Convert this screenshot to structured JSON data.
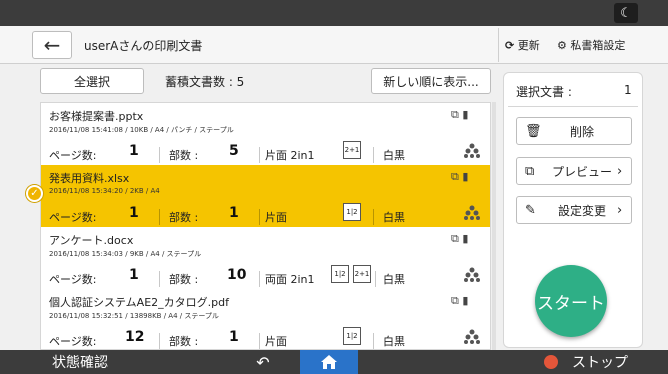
{
  "header": {
    "title": "userAさんの印刷文書",
    "update_label": "更新",
    "mybox_label": "私書箱設定"
  },
  "toolbar": {
    "select_all_label": "全選択",
    "stored_count_label": "蓄積文書数 : 5",
    "sort_label": "新しい順に表示..."
  },
  "labels": {
    "pages": "ページ数:",
    "copies": "部数 :",
    "bw": "白黒"
  },
  "documents": [
    {
      "name": "お客様提案書.pptx",
      "meta": "2016/11/08 15:41:08 / 10KB / A4 / パンチ / ステープル",
      "pages": "1",
      "copies": "5",
      "duplex": "片面 2in1",
      "icon1": "2+1",
      "icon2": "",
      "selected": false
    },
    {
      "name": "発表用資料.xlsx",
      "meta": "2016/11/08 15:34:20 / 2KB / A4",
      "pages": "1",
      "copies": "1",
      "duplex": "片面",
      "icon1": "1|2",
      "icon2": "",
      "selected": true
    },
    {
      "name": "アンケート.docx",
      "meta": "2016/11/08 15:34:03 / 9KB / A4 / ステープル",
      "pages": "1",
      "copies": "10",
      "duplex": "両面 2in1",
      "icon1": "1|2",
      "icon2": "2+1",
      "selected": false
    },
    {
      "name": "個人認証システムAE2_カタログ.pdf",
      "meta": "2016/11/08 15:32:51 / 13898KB / A4 / ステープル",
      "pages": "12",
      "copies": "1",
      "duplex": "片面",
      "icon1": "1|2",
      "icon2": "",
      "selected": false
    }
  ],
  "side_panel": {
    "selected_label": "選択文書 :",
    "selected_count": "1",
    "delete_label": "削除",
    "preview_label": "プレビュー",
    "settings_label": "設定変更",
    "start_label": "スタート"
  },
  "bottom_bar": {
    "status_label": "状態確認",
    "stop_label": "ストップ"
  },
  "icons": {
    "moon": "moon-icon",
    "back": "back-arrow-icon",
    "refresh": "refresh-icon",
    "gear": "gear-icon",
    "trash": "trash-icon",
    "preview": "preview-icon",
    "edit": "edit-icon",
    "home": "home-icon",
    "undo": "undo-icon",
    "stop": "stop-icon"
  },
  "colors": {
    "selected_row": "#f5c400",
    "start_button": "#2eaf86",
    "home_button": "#2a73c9",
    "stop_icon": "#e4563a"
  }
}
